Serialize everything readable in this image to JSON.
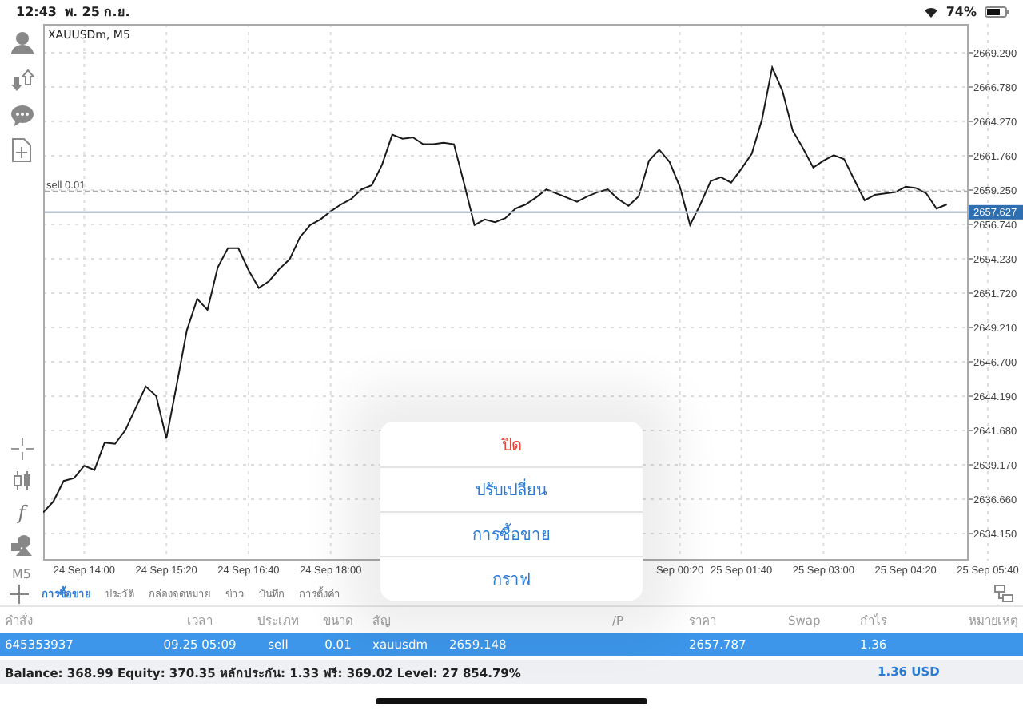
{
  "status_bar": {
    "time": "12:43",
    "date": "พ. 25 ก.ย.",
    "battery": "74%"
  },
  "toolbar": {
    "indicators": "f",
    "timeframe": "M5"
  },
  "chart": {
    "chart_data": {
      "type": "line",
      "title": "XAUUSDm, M5",
      "grid": true,
      "categories": [
        null,
        null,
        null,
        null,
        "24 Sep 14:00",
        null,
        null,
        null,
        null,
        null,
        null,
        null,
        "24 Sep 15:20",
        null,
        null,
        null,
        null,
        null,
        null,
        null,
        "24 Sep 16:40",
        null,
        null,
        null,
        null,
        null,
        null,
        null,
        "24 Sep 18:00",
        null,
        null,
        null,
        null,
        null,
        null,
        null,
        null,
        null,
        null,
        null,
        null,
        null,
        null,
        null,
        null,
        null,
        null,
        null,
        null,
        null,
        null,
        null,
        null,
        null,
        null,
        null,
        null,
        null,
        null,
        null,
        null,
        null,
        "Sep 00:20",
        null,
        null,
        null,
        null,
        null,
        "25 Sep 01:40",
        null,
        null,
        null,
        null,
        null,
        null,
        null,
        "25 Sep 03:00",
        null,
        null,
        null,
        null,
        null,
        null,
        null,
        "25 Sep 04:20",
        null,
        null,
        null,
        null,
        null,
        null,
        null,
        "25 Sep 05:40"
      ],
      "series": [
        {
          "color": "#1a1a1a",
          "values": [
            2635.7,
            2636.5,
            2638.0,
            2638.2,
            2639.1,
            2638.8,
            2640.8,
            2640.7,
            2641.7,
            2643.3,
            2644.9,
            2644.2,
            2641.1,
            2645.0,
            2649.0,
            2651.3,
            2650.5,
            2653.6,
            2655.0,
            2655.0,
            2653.4,
            2652.1,
            2652.6,
            2653.5,
            2654.2,
            2655.8,
            2656.7,
            2657.1,
            2657.7,
            2658.2,
            2658.6,
            2659.3,
            2659.6,
            2661.1,
            2663.3,
            2663.0,
            2663.1,
            2662.6,
            2662.6,
            2662.7,
            2662.6,
            2659.7,
            2656.7,
            2657.1,
            2656.9,
            2657.2,
            2657.9,
            2658.2,
            2658.7,
            2659.3,
            2659.0,
            2658.7,
            2658.4,
            2658.8,
            2659.1,
            2659.3,
            2658.6,
            2658.1,
            2658.8,
            2661.4,
            2662.2,
            2661.3,
            2659.5,
            2656.7,
            2658.2,
            2659.9,
            2660.2,
            2659.8,
            2660.8,
            2661.9,
            2664.4,
            2668.2,
            2666.5,
            2663.6,
            2662.3,
            2660.9,
            2661.4,
            2661.8,
            2661.5,
            2660.0,
            2658.5,
            2658.9,
            2659.0,
            2659.1,
            2659.5,
            2659.4,
            2659.0,
            2657.9,
            2658.2,
            null,
            null,
            null,
            null
          ]
        }
      ],
      "ylim": [
        2632.17,
        2671.39
      ],
      "yticks": [
        {
          "value": 2669.29,
          "label": "2669.290"
        },
        {
          "value": 2666.78,
          "label": "2666.780"
        },
        {
          "value": 2664.27,
          "label": "2664.270"
        },
        {
          "value": 2661.76,
          "label": "2661.760"
        },
        {
          "value": 2659.25,
          "label": "2659.250"
        },
        {
          "value": 2656.74,
          "label": "2656.740"
        },
        {
          "value": 2654.23,
          "label": "2654.230"
        },
        {
          "value": 2651.72,
          "label": "2651.720"
        },
        {
          "value": 2649.21,
          "label": "2649.210"
        },
        {
          "value": 2646.7,
          "label": "2646.700"
        },
        {
          "value": 2644.19,
          "label": "2644.190"
        },
        {
          "value": 2641.68,
          "label": "2641.680"
        },
        {
          "value": 2639.17,
          "label": "2639.170"
        },
        {
          "value": 2636.66,
          "label": "2636.660"
        },
        {
          "value": 2634.15,
          "label": "2634.150"
        }
      ],
      "ref_lines": [
        {
          "axis": "y",
          "value": 2659.148,
          "label": "sell 0.01",
          "color": "#aaaaaa"
        },
        {
          "axis": "y",
          "value": 2657.627,
          "label": "2657.627",
          "color": "#b8c4d0"
        }
      ]
    }
  },
  "tabs": [
    {
      "label": "การซื้อขาย",
      "selected": true
    },
    {
      "label": "ประวัติ",
      "selected": false
    },
    {
      "label": "กล่องจดหมาย",
      "selected": false
    },
    {
      "label": "ข่าว",
      "selected": false
    },
    {
      "label": "บันทึก",
      "selected": false
    },
    {
      "label": "การตั้งค่า",
      "selected": false
    }
  ],
  "table": {
    "columns": [
      "คำสั่ง",
      "เวลา",
      "ประเภท",
      "ขนาด",
      "สัญ",
      "/P",
      "ราคา",
      "Swap",
      "กำไร",
      "หมายเหตุ"
    ],
    "rows": [
      {
        "selected": true,
        "cells": [
          "645353937",
          "09.25 05:09",
          "sell",
          "0.01",
          "xauusdm",
          "",
          "2657.787",
          "",
          "1.36"
        ],
        "open_price": "2659.148"
      }
    ]
  },
  "summary": {
    "text": "Balance: 368.99 Equity: 370.35 หลักประกัน: 1.33 ฟรี: 369.02 Level: 27 854.79%",
    "total": "1.36 USD"
  },
  "action_sheet": {
    "items": [
      {
        "label": "ปิด",
        "kind": "destructive"
      },
      {
        "label": "ปรับเปลี่ยน",
        "kind": "default"
      },
      {
        "label": "การซื้อขาย",
        "kind": "default"
      },
      {
        "label": "กราฟ",
        "kind": "default"
      }
    ]
  }
}
